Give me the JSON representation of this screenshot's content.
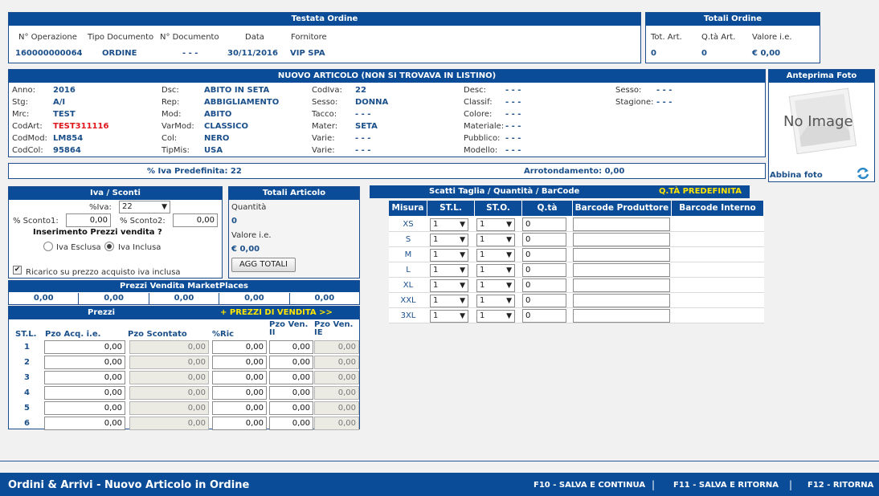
{
  "header": {
    "title": "Testata Ordine",
    "cols": [
      "N° Operazione",
      "Tipo Documento",
      "N° Documento",
      "Data",
      "Fornitore"
    ],
    "values": [
      "160000000064",
      "ORDINE",
      "- - -",
      "30/11/2016",
      "VIP SPA"
    ]
  },
  "totals_order": {
    "title": "Totali Ordine",
    "cols": [
      "Tot. Art.",
      "Q.tà Art.",
      "Valore i.e."
    ],
    "values": [
      "0",
      "0",
      "€ 0,00"
    ]
  },
  "article": {
    "title": "NUOVO ARTICOLO (NON SI TROVAVA IN LISTINO)",
    "col1": [
      {
        "label": "Anno:",
        "value": "2016"
      },
      {
        "label": "Stg:",
        "value": "A/I"
      },
      {
        "label": "Mrc:",
        "value": "TEST"
      },
      {
        "label": "CodArt:",
        "value": "TEST311116"
      },
      {
        "label": "CodMod:",
        "value": "LM854"
      },
      {
        "label": "CodCol:",
        "value": "95864"
      }
    ],
    "col2": [
      {
        "label": "Dsc:",
        "value": "ABITO IN SETA"
      },
      {
        "label": "Rep:",
        "value": "ABBIGLIAMENTO"
      },
      {
        "label": "Mod:",
        "value": "ABITO"
      },
      {
        "label": "VarMod:",
        "value": "CLASSICO"
      },
      {
        "label": "Col:",
        "value": "NERO"
      },
      {
        "label": "TipMis:",
        "value": "USA"
      }
    ],
    "col3": [
      {
        "label": "CodIva:",
        "value": "22"
      },
      {
        "label": "Sesso:",
        "value": "DONNA"
      },
      {
        "label": "Tacco:",
        "value": "- - -"
      },
      {
        "label": "Mater:",
        "value": "SETA"
      },
      {
        "label": "Varie:",
        "value": "- - -"
      },
      {
        "label": "Varie:",
        "value": "- - -"
      }
    ],
    "col4": [
      {
        "label": "Desc:",
        "value": "- - -"
      },
      {
        "label": "Classif:",
        "value": "- - -"
      },
      {
        "label": "Colore:",
        "value": "- - -"
      },
      {
        "label": "Materiale:",
        "value": "- - -"
      },
      {
        "label": "Pubblico:",
        "value": "- - -"
      },
      {
        "label": "Modello:",
        "value": "- - -"
      }
    ],
    "col5": [
      {
        "label": "Sesso:",
        "value": "- - -"
      },
      {
        "label": "Stagione:",
        "value": "- - -"
      }
    ]
  },
  "photo": {
    "title": "Anteprima Foto",
    "no_image": "No Image",
    "link": "Abbina foto",
    "refresh_icon": "refresh-icon"
  },
  "info_bar": {
    "iva": "% Iva Predefinita: 22",
    "rounding": "Arrotondamento: 0,00"
  },
  "iva_sconti": {
    "title": "Iva / Sconti",
    "iva_label": "%Iva:",
    "iva_value": "22",
    "sconto1_label": "% Sconto1:",
    "sconto1_value": "0,00",
    "sconto2_label": "% Sconto2:",
    "sconto2_value": "0,00",
    "insert_label": "Inserimento Prezzi vendita ?",
    "radio_esclusa": "Iva Esclusa",
    "radio_inclusa": "Iva Inclusa",
    "selected_radio": "Iva Inclusa",
    "checkbox_label": "Ricarico su prezzo acquisto iva inclusa",
    "checkbox_checked": true
  },
  "totali_articolo": {
    "title": "Totali Articolo",
    "qty_label": "Quantità",
    "qty_value": "0",
    "value_label": "Valore i.e.",
    "value_value": "€ 0,00",
    "button": "AGG TOTALI"
  },
  "marketplaces": {
    "title": "Prezzi Vendita MarketPlaces",
    "values": [
      "0,00",
      "0,00",
      "0,00",
      "0,00",
      "0,00"
    ]
  },
  "prezzi": {
    "title": "Prezzi",
    "link": "+ PREZZI DI VENDITA >>",
    "headers": [
      "ST.L.",
      "Pzo Acq. i.e.",
      "Pzo Scontato",
      "%Ric",
      "Pzo Ven. II",
      "Pzo Ven. IE"
    ],
    "rows": [
      {
        "stl": "1",
        "acq": "0,00",
        "sco": "0,00",
        "ric": "0,00",
        "ii": "0,00",
        "ie": "0,00"
      },
      {
        "stl": "2",
        "acq": "0,00",
        "sco": "0,00",
        "ric": "0,00",
        "ii": "0,00",
        "ie": "0,00"
      },
      {
        "stl": "3",
        "acq": "0,00",
        "sco": "0,00",
        "ric": "0,00",
        "ii": "0,00",
        "ie": "0,00"
      },
      {
        "stl": "4",
        "acq": "0,00",
        "sco": "0,00",
        "ric": "0,00",
        "ii": "0,00",
        "ie": "0,00"
      },
      {
        "stl": "5",
        "acq": "0,00",
        "sco": "0,00",
        "ric": "0,00",
        "ii": "0,00",
        "ie": "0,00"
      },
      {
        "stl": "6",
        "acq": "0,00",
        "sco": "0,00",
        "ric": "0,00",
        "ii": "0,00",
        "ie": "0,00"
      }
    ]
  },
  "scatti": {
    "title": "Scatti Taglia / Quantità / BarCode",
    "link": "Q.TÀ PREDEFINITA",
    "headers": [
      "Misura",
      "ST.L.",
      "ST.O.",
      "Q.tà",
      "Barcode Produttore",
      "Barcode Interno"
    ],
    "rows": [
      {
        "misura": "XS",
        "stl": "1",
        "sto": "1",
        "qta": "0"
      },
      {
        "misura": "S",
        "stl": "1",
        "sto": "1",
        "qta": "0"
      },
      {
        "misura": "M",
        "stl": "1",
        "sto": "1",
        "qta": "0"
      },
      {
        "misura": "L",
        "stl": "1",
        "sto": "1",
        "qta": "0"
      },
      {
        "misura": "XL",
        "stl": "1",
        "sto": "1",
        "qta": "0"
      },
      {
        "misura": "XXL",
        "stl": "1",
        "sto": "1",
        "qta": "0"
      },
      {
        "misura": "3XL",
        "stl": "1",
        "sto": "1",
        "qta": "0"
      }
    ]
  },
  "footer": {
    "title": "Ordini & Arrivi - Nuovo Articolo in Ordine",
    "actions": [
      "F10 - SALVA E CONTINUA",
      "F11 - SALVA E RITORNA",
      "F12 - RITORNA"
    ]
  },
  "colors": {
    "header_blue": "#0a4c97",
    "value_blue": "#1a4f8a",
    "accent_red": "#e0151b",
    "accent_yellow": "#ffe500"
  }
}
